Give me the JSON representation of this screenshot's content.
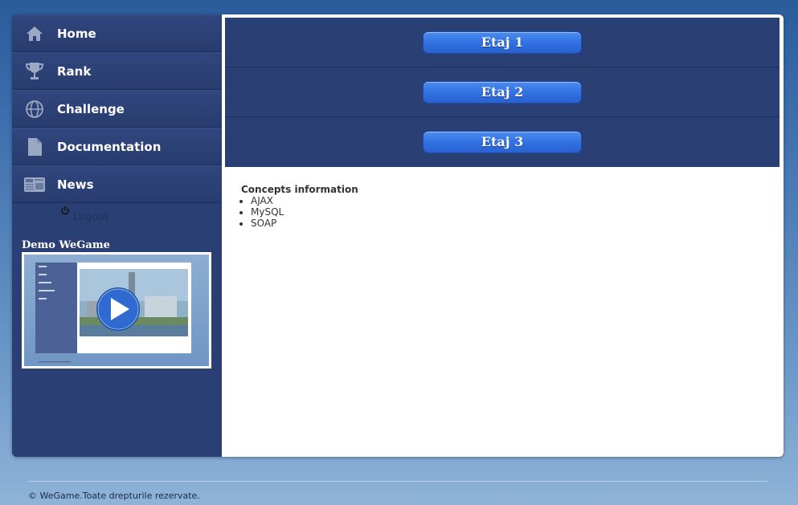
{
  "nav": {
    "items": [
      {
        "label": "Home",
        "icon": "home-icon"
      },
      {
        "label": "Rank",
        "icon": "trophy-icon"
      },
      {
        "label": "Challenge",
        "icon": "globe-icon"
      },
      {
        "label": "Documentation",
        "icon": "document-icon"
      },
      {
        "label": "News",
        "icon": "newspaper-icon"
      }
    ],
    "logout_label": "Logout"
  },
  "demo": {
    "title": "Demo WeGame"
  },
  "levels": [
    "Etaj 1",
    "Etaj 2",
    "Etaj 3"
  ],
  "concepts": {
    "title": "Concepts information",
    "items": [
      "AJAX",
      "MySQL",
      "SOAP"
    ]
  },
  "footer": {
    "text": "© WeGame.Toate drepturile rezervate."
  },
  "colors": {
    "sidebar": "#2a3f73",
    "button": "#2f6fe0",
    "background_top": "#2a5c9c",
    "background_bottom": "#8fb3d8"
  }
}
